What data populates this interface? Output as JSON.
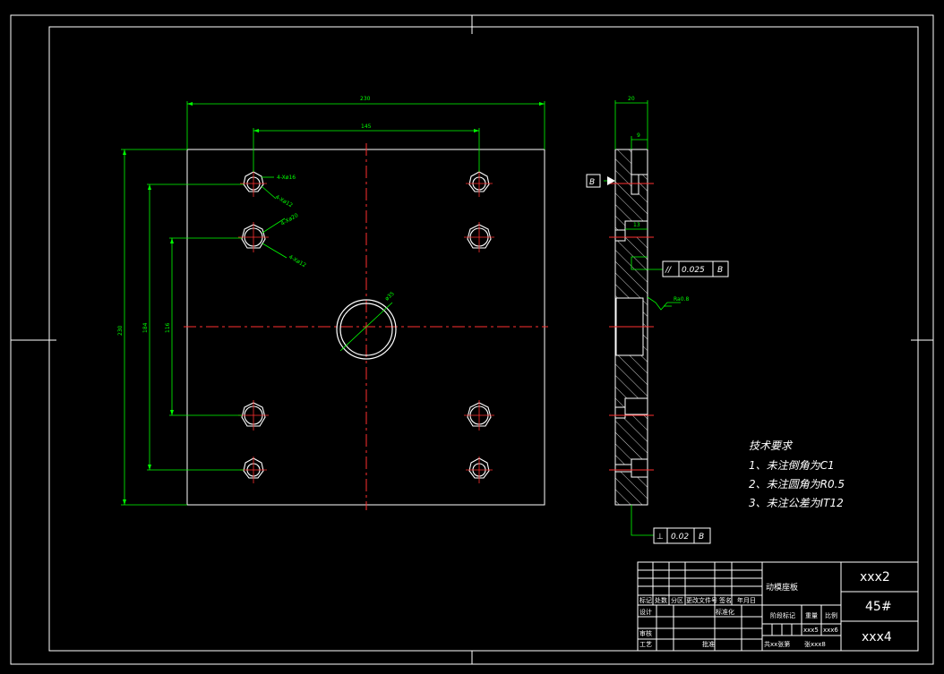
{
  "colors": {
    "background": "#000000",
    "outline": "#ffffff",
    "dimension": "#00ff00",
    "center": "#ff3030"
  },
  "front_view": {
    "dim_overall_width": "230",
    "dim_hole_span_x": "145",
    "dim_overall_height": "230",
    "dim_hole_span_y_outer": "184",
    "dim_hole_span_y_inner": "116",
    "callout_a": "4-Xø16",
    "callout_b": "4-Xø12",
    "callout_c": "4-Xø20",
    "callout_d": "4-Xø12",
    "center_hole": "ø35"
  },
  "side_view": {
    "dim_thickness": "20",
    "dim_counterbore_top": "9",
    "dim_counterbore_mid": "13",
    "datum": "B",
    "roughness": "Ra0.8",
    "tol_parallel": {
      "symbol": "//",
      "value": "0.025",
      "datum": "B"
    },
    "tol_perpendicular": {
      "symbol": "⊥",
      "value": "0.02",
      "datum": "B"
    }
  },
  "notes": {
    "title": "技术要求",
    "items": [
      "1、未注倒角为C1",
      "2、未注圆角为R0.5",
      "3、未注公差为IT12"
    ]
  },
  "title_block": {
    "part_name": "动模座板",
    "drawing_no": "xxx2",
    "material": "45#",
    "company": "xxx4",
    "mark_label": "标记",
    "count_label": "处数",
    "zone_label": "分区",
    "change_doc_label": "更改文件号",
    "sign_label": "签名",
    "date_label": "年月日",
    "design_label": "设计",
    "standardize_label": "标准化",
    "review_label": "审核",
    "process_label": "工艺",
    "approve_label": "批准",
    "stage_label": "阶段标记",
    "weight_label": "重量",
    "scale_label": "比例",
    "weight_value": "xxx5",
    "scale_value": "xxx6",
    "sheets_text": "共xx张第",
    "sheet_text": "张xxx8"
  }
}
